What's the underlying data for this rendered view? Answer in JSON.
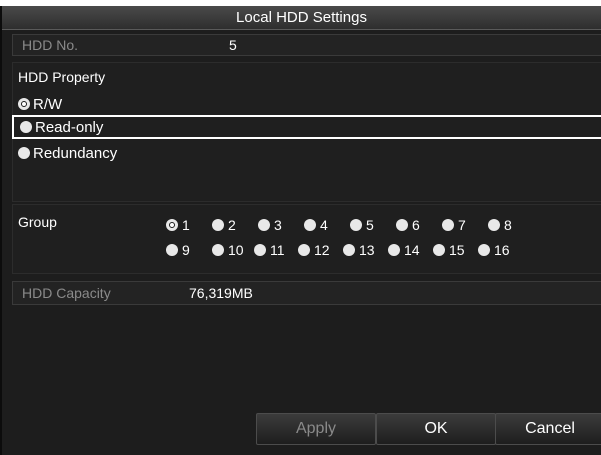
{
  "dialog": {
    "title": "Local HDD Settings"
  },
  "hdd_no": {
    "label": "HDD No.",
    "value": "5"
  },
  "property": {
    "label": "HDD Property",
    "options": [
      {
        "label": "R/W",
        "checked": true
      },
      {
        "label": "Read-only",
        "checked": false,
        "focused": true
      },
      {
        "label": "Redundancy",
        "checked": false
      }
    ]
  },
  "group": {
    "label": "Group",
    "options": [
      "1",
      "2",
      "3",
      "4",
      "5",
      "6",
      "7",
      "8",
      "9",
      "10",
      "11",
      "12",
      "13",
      "14",
      "15",
      "16"
    ],
    "selected": "1"
  },
  "capacity": {
    "label": "HDD Capacity",
    "value": "76,319MB"
  },
  "buttons": {
    "apply": "Apply",
    "ok": "OK",
    "cancel": "Cancel"
  }
}
